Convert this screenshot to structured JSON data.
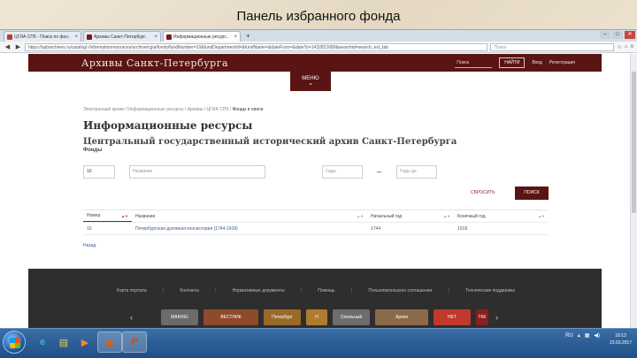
{
  "slide": {
    "title": "Панель избранного фонда"
  },
  "browser": {
    "tabs": [
      {
        "label": "ЦГИА СПб - Поиск по фон..",
        "favicon_color": "#c0392b"
      },
      {
        "label": "Архивы Санкт-Петербург..",
        "favicon_color": "#7a1c1c"
      },
      {
        "label": "Информационные ресурс..",
        "favicon_color": "#7a1c1c"
      }
    ],
    "new_tab": "+",
    "url": "https://spbarchives.ru/catalog/-/informationresources/archive/cgia/fonds/fundNumber=10&fundDepartmentId=&fundName=&dateFrom=&dateTo=1432821689&searchid=search_ext_tab",
    "search_placeholder": "Поиск",
    "window_controls": {
      "min": "–",
      "max": "□",
      "close": "✕"
    }
  },
  "site": {
    "title": "Архивы Санкт-Петербурга",
    "header_search_placeholder": "Поиск",
    "find_button": "НАЙТИ",
    "login": "Вход",
    "register": "Регистрация",
    "menu_label": "МЕНЮ",
    "menu_chevron": "⌄",
    "breadcrumb": {
      "items": [
        "Электронный архив",
        "Информационные ресурсы",
        "Архивы",
        "ЦГИА СПб"
      ],
      "current": "Фонды и описи",
      "separator": "/"
    },
    "heading": "Информационные ресурсы",
    "archive_name": "Центральный государственный исторический архив Санкт-Петербурга",
    "fonds_label": "Фонды",
    "filters": {
      "fund_number": "10",
      "name_placeholder": "Название",
      "year_from_placeholder": "Годы",
      "dash": "–",
      "year_to_placeholder": "Годы до"
    },
    "reset_label": "СБРОСИТЬ",
    "search_button": "ПОИСК",
    "table": {
      "headers": [
        "Номер",
        "Название",
        "Начальный год",
        "Конечный год"
      ],
      "rows": [
        [
          "10",
          "Петербургская духовная консистория (1744-1918)",
          "1744",
          "1918"
        ]
      ]
    },
    "back_link": "Назад",
    "footer": {
      "links": [
        "Карта портала",
        "Контакты",
        "Нормативные документы",
        "Помощь",
        "Пользовательское соглашение",
        "Технические поддержка"
      ],
      "prev": "‹",
      "next": "›",
      "logos": [
        {
          "text": "MAKING",
          "color": "#6b6b6b"
        },
        {
          "text": "ВЕСТНИК",
          "color": "#8d4b2a"
        },
        {
          "text": "Петербург",
          "color": "#9a6a2a"
        },
        {
          "text": "Н",
          "color": "#b07a2f"
        },
        {
          "text": "Смольный",
          "color": "#6d6d6d"
        },
        {
          "text": "Архив",
          "color": "#8a6a4a"
        },
        {
          "text": "НЕТ",
          "color": "#c0392b"
        },
        {
          "text": "ГКК",
          "color": "#8a1f1f"
        }
      ]
    }
  },
  "taskbar": {
    "items": [
      {
        "icon": "ie-icon",
        "glyph": "e",
        "color": "#3fa9f5"
      },
      {
        "icon": "folder-icon",
        "glyph": "▤",
        "color": "#f2c94c"
      },
      {
        "icon": "media-icon",
        "glyph": "▶",
        "color": "#f08a24"
      },
      {
        "icon": "firefox-icon",
        "glyph": "◉",
        "color": "#e66000"
      },
      {
        "icon": "powerpoint-icon",
        "glyph": "P",
        "color": "#d24726"
      }
    ],
    "language": "RU",
    "time": "18:13",
    "date": "23.03.2017"
  }
}
